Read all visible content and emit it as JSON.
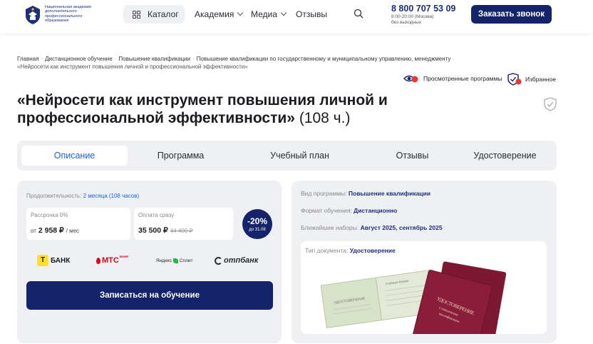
{
  "header": {
    "logo_text": "Национальная академия дополнительного профессионального образования",
    "catalog_label": "Каталог",
    "nav": [
      {
        "label": "Академия",
        "dropdown": true
      },
      {
        "label": "Медиа",
        "dropdown": true
      },
      {
        "label": "Отзывы",
        "dropdown": false
      }
    ],
    "phone": "8 800 707 53 09",
    "hours_line1": "8:00-20:00 (Москва)",
    "hours_line2": "без выходных",
    "call_button": "Заказать звонок"
  },
  "breadcrumbs": [
    "Главная",
    "Дистанционное обучение",
    "Повышение квалификации",
    "Повышение квалификации по государственному и муниципальному управлению, менеджменту"
  ],
  "breadcrumb_current": "«Нейросети как инструмент повышения личной и профессиональной эффективности»",
  "viewed_label": "Просмотренные программы",
  "favorites_label": "Избранное",
  "title": {
    "line1": "«Нейросети как инструмент повышения личной и",
    "line2": "профессиональной эффективности»",
    "hours": "(108 ч.)"
  },
  "tabs": [
    {
      "label": "Описание",
      "active": true
    },
    {
      "label": "Программа",
      "active": false
    },
    {
      "label": "Учебный план",
      "active": false
    },
    {
      "label": "Отзывы",
      "active": false
    },
    {
      "label": "Удостоверение",
      "active": false
    }
  ],
  "pricing": {
    "duration_label": "Продолжительность:",
    "duration_value": "2 месяца (108 часов)",
    "installment_label": "Рассрочка 0%",
    "installment_prefix": "от",
    "installment_value": "2 958 ₽",
    "installment_unit": "/ мес",
    "full_label": "Оплата сразу",
    "full_price": "35 500 ₽",
    "old_price": "44 400 ₽",
    "discount_pct": "-20%",
    "discount_until": "до 31.08"
  },
  "banks": [
    {
      "name": "БАНК",
      "prefix": "Т",
      "color": "#1a1c20"
    },
    {
      "name": "МТС",
      "suffix": "БАНК",
      "color": "#e3061a"
    },
    {
      "name": "Яндекс",
      "suffix": "Сплит",
      "color": "#222222"
    },
    {
      "name": "отпбанк",
      "color": "#2a2d33"
    }
  ],
  "enroll_button": "Записаться на обучение",
  "program_info": {
    "type_label": "Вид программы:",
    "type_value": "Повышение квалификации",
    "format_label": "Формат обучения:",
    "format_value": "Дистанционно",
    "dates_label": "Ближайшие наборы:",
    "dates_value": "Август 2025, сентябрь 2025",
    "doc_label": "Тип документа:",
    "doc_value": "Удостоверение"
  },
  "certificate_image": {
    "front_text": "УДОСТОВЕРЕНИЕ о повышении квалификации",
    "inner_left_title": "УДОСТОВЕРЕНИЕ",
    "inner_right_title": "Учебная Форма"
  },
  "colors": {
    "brand_navy": "#15236b",
    "link_blue": "#1f63d6",
    "panel_gray": "#eef0f3",
    "cover_red": "#8a1c3c"
  }
}
